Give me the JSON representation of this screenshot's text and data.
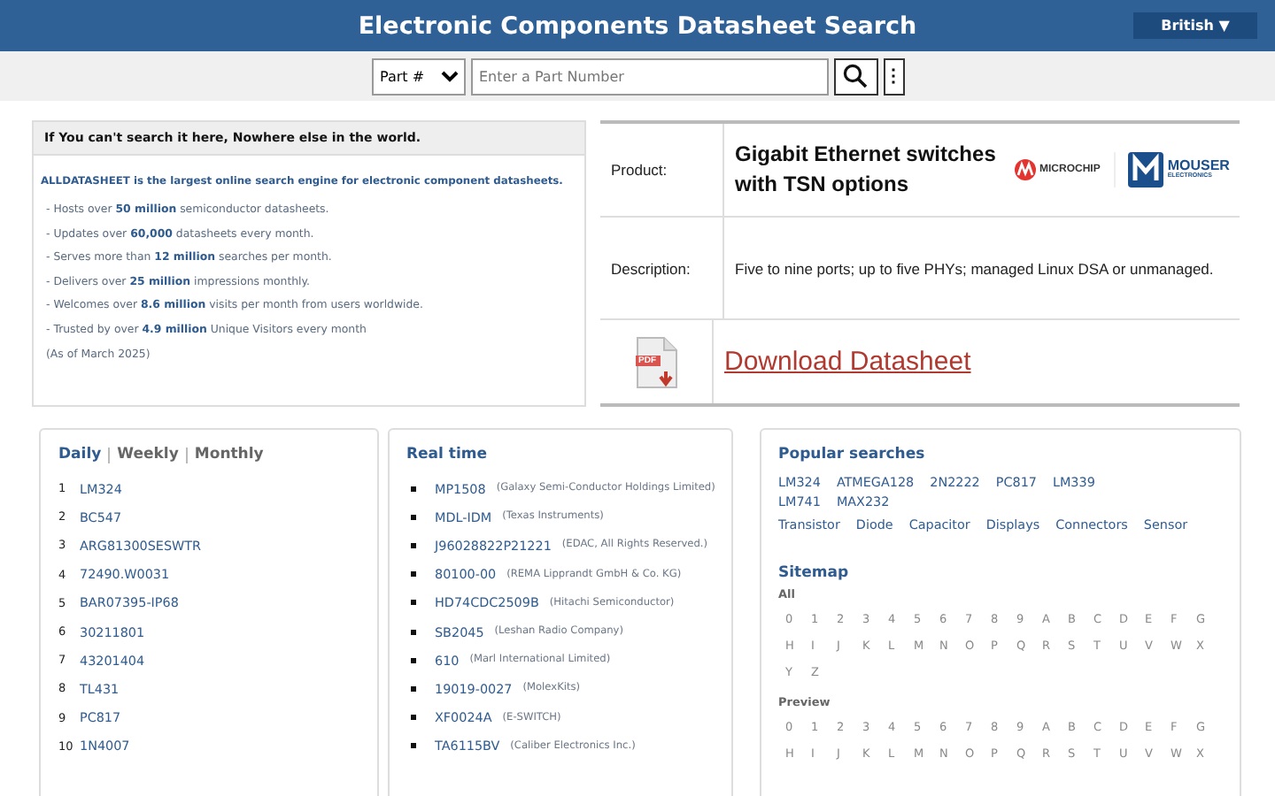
{
  "header": {
    "title": "Electronic Components Datasheet Search",
    "language": "British ▼"
  },
  "search": {
    "type": "Part #",
    "placeholder": "Enter a Part Number",
    "more": "⋮"
  },
  "intro": {
    "heading": "If You can't search it here, Nowhere else in the world.",
    "lead": "ALLDATASHEET is the largest online search engine for electronic component datasheets.",
    "points": [
      "- Hosts over **50 million** semiconductor datasheets.",
      "- Updates over **60,000** datasheets every month.",
      "- Serves more than **12 million** searches per month.",
      "- Delivers over **25 million** impressions monthly.",
      "- Welcomes over **8.6 million** visits per month from users worldwide.",
      "- Trusted by over **4.9 million** Unique Visitors every month",
      "(As of March 2025)"
    ]
  },
  "ad": {
    "product_label": "Product:",
    "product": "Gigabit Ethernet switches with TSN options",
    "microchip": "MICROCHIP",
    "mouser": "MOUSER",
    "mouser_sub": "ELECTRONICS",
    "description_label": "Description:",
    "description": "Five to nine ports; up to five PHYs; managed Linux DSA or unmanaged.",
    "pdf": "PDF",
    "download": "Download Datasheet"
  },
  "ranking": {
    "tabs": [
      {
        "label": "Daily",
        "selected": true
      },
      {
        "label": "Weekly",
        "selected": false
      },
      {
        "label": "Monthly",
        "selected": false
      }
    ],
    "items": [
      {
        "rank": "1",
        "part": "LM324"
      },
      {
        "rank": "2",
        "part": "BC547"
      },
      {
        "rank": "3",
        "part": "ARG81300SESWTR"
      },
      {
        "rank": "4",
        "part": "72490.W0031"
      },
      {
        "rank": "5",
        "part": "BAR07395-IP68"
      },
      {
        "rank": "6",
        "part": "30211801"
      },
      {
        "rank": "7",
        "part": "43201404"
      },
      {
        "rank": "8",
        "part": "TL431"
      },
      {
        "rank": "9",
        "part": "PC817"
      },
      {
        "rank": "10",
        "part": "1N4007"
      }
    ]
  },
  "realtime": {
    "title": "Real time",
    "items": [
      {
        "part": "MP1508",
        "maker": "(Galaxy Semi-Conductor Holdings Limited)"
      },
      {
        "part": "MDL-IDM",
        "maker": "(Texas Instruments)"
      },
      {
        "part": "J96028822P21221",
        "maker": "(EDAC, All Rights Reserved.)"
      },
      {
        "part": "80100-00",
        "maker": "(REMA Lipprandt GmbH & Co. KG)"
      },
      {
        "part": "HD74CDC2509B",
        "maker": "(Hitachi Semiconductor)"
      },
      {
        "part": "SB2045",
        "maker": "(Leshan Radio Company)"
      },
      {
        "part": "610",
        "maker": "(Marl International Limited)"
      },
      {
        "part": "19019-0027",
        "maker": "(MolexKits)"
      },
      {
        "part": "XF0024A",
        "maker": "(E-SWITCH)"
      },
      {
        "part": "TA6115BV",
        "maker": "(Caliber Electronics Inc.)"
      }
    ]
  },
  "popular": {
    "title": "Popular searches",
    "parts": [
      "LM324",
      "ATMEGA128",
      "2N2222",
      "PC817",
      "LM339",
      "LM741",
      "MAX232"
    ],
    "categories": [
      "Transistor",
      "Diode",
      "Capacitor",
      "Displays",
      "Connectors",
      "Sensor"
    ]
  },
  "sitemap": {
    "title": "Sitemap",
    "groups": [
      {
        "label": "All",
        "rows": [
          [
            "0",
            "1",
            "2",
            "3",
            "4",
            "5",
            "6",
            "7",
            "8",
            "9",
            "A",
            "B",
            "C",
            "D",
            "E",
            "F",
            "G"
          ],
          [
            "H",
            "I",
            "J",
            "K",
            "L",
            "M",
            "N",
            "O",
            "P",
            "Q",
            "R",
            "S",
            "T",
            "U",
            "V",
            "W",
            "X"
          ],
          [
            "Y",
            "Z"
          ]
        ]
      },
      {
        "label": "Preview",
        "rows": [
          [
            "0",
            "1",
            "2",
            "3",
            "4",
            "5",
            "6",
            "7",
            "8",
            "9",
            "A",
            "B",
            "C",
            "D",
            "E",
            "F",
            "G"
          ],
          [
            "H",
            "I",
            "J",
            "K",
            "L",
            "M",
            "N",
            "O",
            "P",
            "Q",
            "R",
            "S",
            "T",
            "U",
            "V",
            "W",
            "X"
          ]
        ]
      }
    ]
  }
}
